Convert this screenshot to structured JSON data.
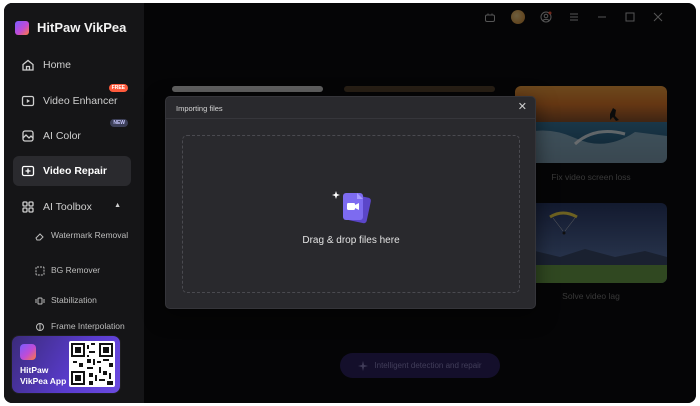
{
  "app": {
    "name": "HitPaw VikPea"
  },
  "sidebar": {
    "items": [
      {
        "label": "Home",
        "icon": "home-icon"
      },
      {
        "label": "Video Enhancer",
        "icon": "video-enhancer-icon",
        "badge": "FREE"
      },
      {
        "label": "AI Color",
        "icon": "ai-color-icon",
        "badge": "NEW"
      },
      {
        "label": "Video Repair",
        "icon": "video-repair-icon",
        "active": true
      },
      {
        "label": "AI Toolbox",
        "icon": "toolbox-icon",
        "expanded": true
      }
    ],
    "toolbox_items": [
      {
        "label": "Watermark Removal",
        "icon": "eraser-icon"
      },
      {
        "label": "BG Remover",
        "icon": "bg-remover-icon"
      },
      {
        "label": "Stabilization",
        "icon": "stabilization-icon"
      },
      {
        "label": "Frame Interpolation",
        "icon": "frame-interpolation-icon"
      }
    ],
    "app_promo": {
      "label": "HitPaw VikPea App"
    }
  },
  "main": {
    "cards": [
      {
        "caption": "Fix video screen loss"
      },
      {
        "caption": "Solve video lag"
      }
    ],
    "detect_button": "Intelligent detection and repair"
  },
  "modal": {
    "title": "Importing files",
    "drop_label": "Drag & drop files here"
  },
  "colors": {
    "accent": "#6b5cff",
    "background": "#0c0c0e",
    "sidebar": "#151517",
    "modal": "#29292d"
  }
}
